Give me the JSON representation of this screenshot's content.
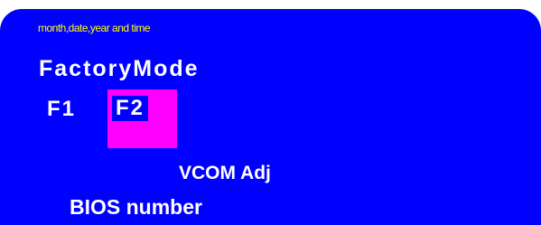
{
  "screen": {
    "header_note": "month,date,year and time",
    "title": "FactoryMode",
    "pages": [
      "F1",
      "F2"
    ],
    "selected_page": "F2",
    "menu_item": "VCOM Adj",
    "bios_label": "BIOS number"
  },
  "colors": {
    "background": "#0000ff",
    "note_text": "#ffff00",
    "text": "#ffffff",
    "highlight": "#ff00ff"
  }
}
